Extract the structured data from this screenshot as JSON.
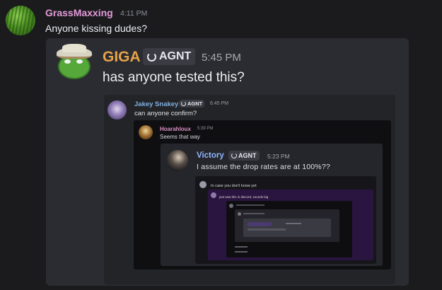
{
  "outer": {
    "username": "GrassMaxxing",
    "time": "4:11 PM",
    "text": "Anyone kissing dudes?"
  },
  "giga": {
    "username": "GIGA",
    "badge": "AGNT",
    "time": "5:45 PM",
    "text": "has anyone tested this?"
  },
  "jakey": {
    "username": "Jakey Snakey",
    "badge": "AGNT",
    "time": "6:45 PM",
    "text": "can anyone confirm?"
  },
  "hoar": {
    "username": "Hoarahloux",
    "time": "5:39 PM",
    "text": "Seems that way"
  },
  "victory": {
    "username": "Victory",
    "badge": "AGNT",
    "time": "5:23 PM",
    "text": "I assume the drop rates are at 100%??"
  },
  "nested": {
    "level5_text": "In case you don't know yet",
    "level6_text": "just saw this in discord, sounds big"
  },
  "icons": {
    "badge_icon": "crescent-icon"
  }
}
